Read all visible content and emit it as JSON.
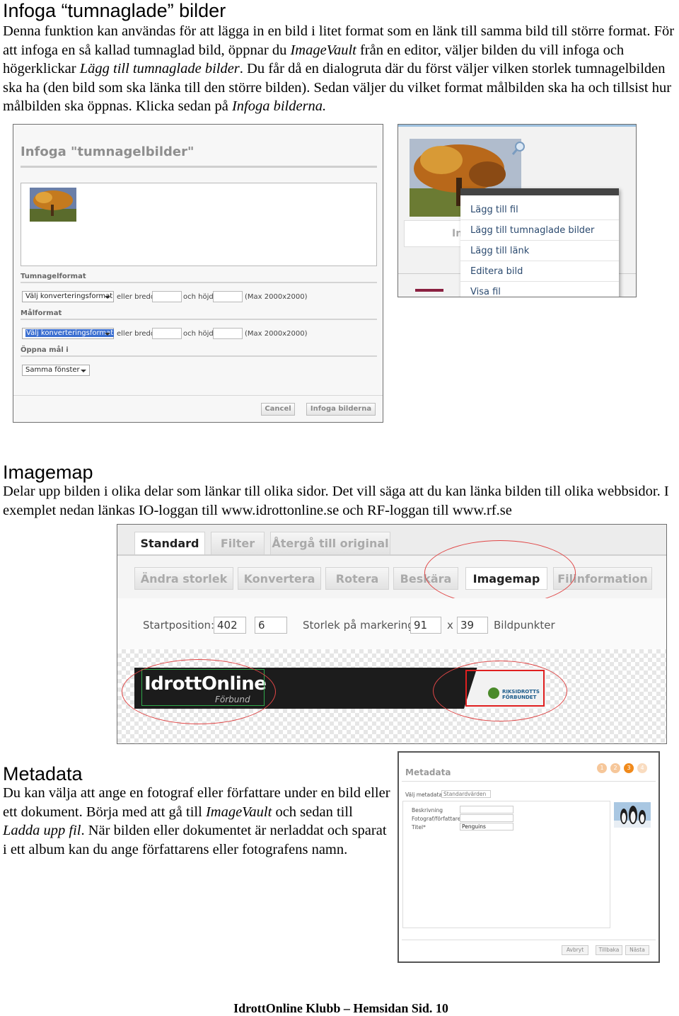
{
  "section1": {
    "heading": "Infoga “tumnaglade” bilder",
    "p1": "Denna funktion kan användas för att lägga in en bild i litet format som en länk till samma bild till större format. För att infoga en så kallad tumnaglad bild, öppnar du ",
    "em1": "ImageVault",
    "p2": " från en editor, väljer bilden du vill infoga och högerklickar ",
    "em2": "Lägg till tumnaglade bilder",
    "p3": ". Du får då en dialogruta där du först väljer vilken storlek tumnagelbilden ska ha (den bild som ska länka till den större bilden). Sedan väljer du vilket format målbilden ska ha och tillsist hur målbilden ska öppnas. Klicka sedan på ",
    "em3": "Infoga bilderna.",
    "dialog": {
      "title": "Infoga \"tumnagelbilder\"",
      "thumb_label": "Tumnagelformat",
      "target_label": "Målformat",
      "open_label": "Öppna mål i",
      "format_select": "Välj konverteringsformat",
      "or_width": "eller bredd",
      "and_height": "och höjd",
      "max": "(Max 2000x2000)",
      "open_select": "Samma fönster",
      "cancel": "Cancel",
      "insert": "Infoga bilderna"
    },
    "context_menu": {
      "partial": "In",
      "items": [
        "Lägg till fil",
        "Lägg till tumnaglade bilder",
        "Lägg till länk",
        "Editera bild",
        "Visa fil"
      ]
    }
  },
  "section2": {
    "heading": "Imagemap",
    "text": "Delar upp bilden i olika delar som länkar till olika sidor. Det vill säga att du kan länka bilden till olika webbsidor. I exemplet nedan länkas IO-loggan till www.idrottonline.se och RF-loggan till www.rf.se",
    "tabs": [
      "Standard",
      "Filter",
      "Återgå till original"
    ],
    "tools": [
      "Ändra storlek",
      "Konvertera",
      "Rotera",
      "Beskära",
      "Imagemap",
      "Filinformation"
    ],
    "start_label": "Startposition:",
    "start_x": "402",
    "start_y": "6",
    "size_label": "Storlek på markering:",
    "size_w": "91",
    "size_x": "x",
    "size_h": "39",
    "unit": "Bildpunkter",
    "logo_main": "IdrottOnline",
    "logo_sub": "Förbund",
    "rf_logo": "RIKSIDROTTS FÖRBUNDET"
  },
  "section3": {
    "heading": "Metadata",
    "p1": "Du kan välja att ange en fotograf eller författare under en bild eller ett dokument. Börja med att gå till ",
    "em1": "ImageVault",
    "p2": " och sedan till ",
    "em2": "Ladda upp fil",
    "p3": ". När bilden eller dokumentet är nerladdat och sparat i ett album kan du ange författarens eller fotografens namn.",
    "panel": {
      "title": "Metadata",
      "steps": [
        "1",
        "2",
        "3",
        "4"
      ],
      "choose_label": "Välj metadata:",
      "choose_value": "Standardvärden",
      "f1": "Beskrivning",
      "f2": "Fotograf/författare",
      "f3": "Titel*",
      "f3_value": "Penguins",
      "cancel": "Avbryt",
      "back": "Tillbaka",
      "next": "Nästa"
    }
  },
  "footer": "IdrottOnline Klubb – Hemsidan Sid. 10",
  "colors": {
    "accent_red": "#e04646",
    "menu_text": "#2b4a6f",
    "step_active": "#f08a1c"
  }
}
